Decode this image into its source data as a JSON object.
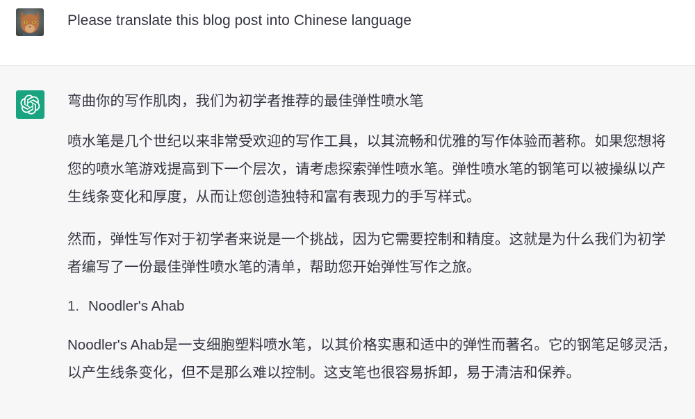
{
  "user": {
    "message": "Please translate this blog post into Chinese language",
    "avatar_icon": "cat-avatar-photo"
  },
  "assistant": {
    "avatar_icon": "openai-logo-icon",
    "avatar_color": "#19a37f",
    "title": "弯曲你的写作肌肉，我们为初学者推荐的最佳弹性喷水笔",
    "paragraphs": [
      "喷水笔是几个世纪以来非常受欢迎的写作工具，以其流畅和优雅的写作体验而著称。如果您想将您的喷水笔游戏提高到下一个层次，请考虑探索弹性喷水笔。弹性喷水笔的钢笔可以被操纵以产生线条变化和厚度，从而让您创造独特和富有表现力的手写样式。",
      "然而，弹性写作对于初学者来说是一个挑战，因为它需要控制和精度。这就是为什么我们为初学者编写了一份最佳弹性喷水笔的清单，帮助您开始弹性写作之旅。"
    ],
    "list": [
      {
        "number": "1.",
        "text": "Noodler's Ahab"
      }
    ],
    "after_list": "Noodler's Ahab是一支细胞塑料喷水笔，以其价格实惠和适中的弹性而著名。它的钢笔足够灵活，以产生线条变化，但不是那么难以控制。这支笔也很容易拆卸，易于清洁和保养。"
  }
}
